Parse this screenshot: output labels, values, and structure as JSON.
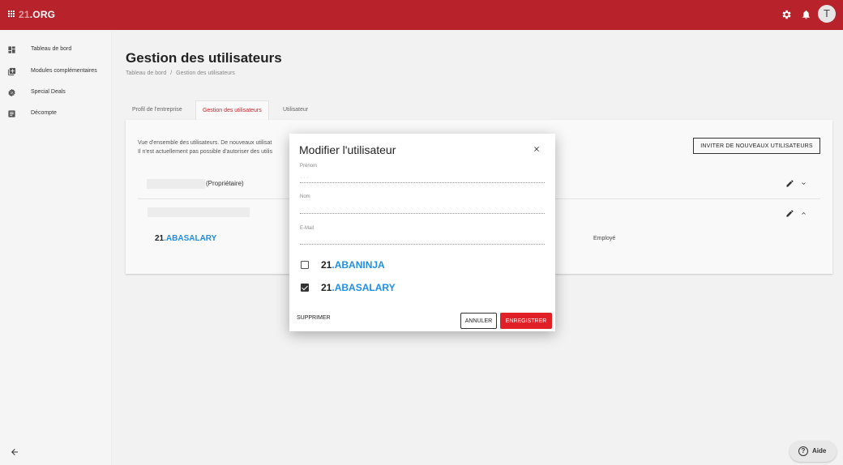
{
  "topbar": {
    "brand_prefix": "21",
    "brand_suffix": ".ORG",
    "avatar_initial": "T",
    "color": "#b8232b"
  },
  "sidebar": {
    "items": [
      {
        "label": "Tableau de bord",
        "icon": "dashboard-icon"
      },
      {
        "label": "Modules complémentaires",
        "icon": "add-module-icon"
      },
      {
        "label": "Special Deals",
        "icon": "deals-icon"
      },
      {
        "label": "Décompte",
        "icon": "invoice-icon"
      }
    ]
  },
  "page": {
    "title": "Gestion des utilisateurs",
    "breadcrumb": [
      "Tableau de bord",
      "Gestion des utilisateurs"
    ],
    "breadcrumb_sep": "/"
  },
  "tabs": [
    {
      "label": "Profil de l'entreprise",
      "active": false
    },
    {
      "label": "Gestion des utilisateurs",
      "active": true
    },
    {
      "label": "Utilisateur",
      "active": false
    }
  ],
  "card": {
    "description_line1": "Vue d'ensemble des utilisateurs. De nouveaux utilisat",
    "description_line2": "Il n'est actuellement pas possible d'autoriser des utilis",
    "invite_label": "INVITER DE NOUVEAUX UTILISATEURS",
    "users": [
      {
        "role_label": "(Propriétaire)"
      },
      {
        "product_prefix": "21",
        "product_name": "ABASALARY",
        "role": "Employé"
      }
    ]
  },
  "dialog": {
    "title": "Modifier l'utilisateur",
    "fields": [
      {
        "label": "Prénom",
        "value": "· · ·"
      },
      {
        "label": "Nom",
        "value": ""
      },
      {
        "label": "E-Mail",
        "value": ""
      }
    ],
    "products": [
      {
        "prefix": "21",
        "name": "ABANINJA",
        "checked": false
      },
      {
        "prefix": "21",
        "name": "ABASALARY",
        "checked": true
      }
    ],
    "delete_label": "SUPPRIMER",
    "cancel_label": "ANNULER",
    "save_label": "ENREGISTRER",
    "save_color": "#e11f26"
  },
  "help": {
    "label": "Aide"
  }
}
